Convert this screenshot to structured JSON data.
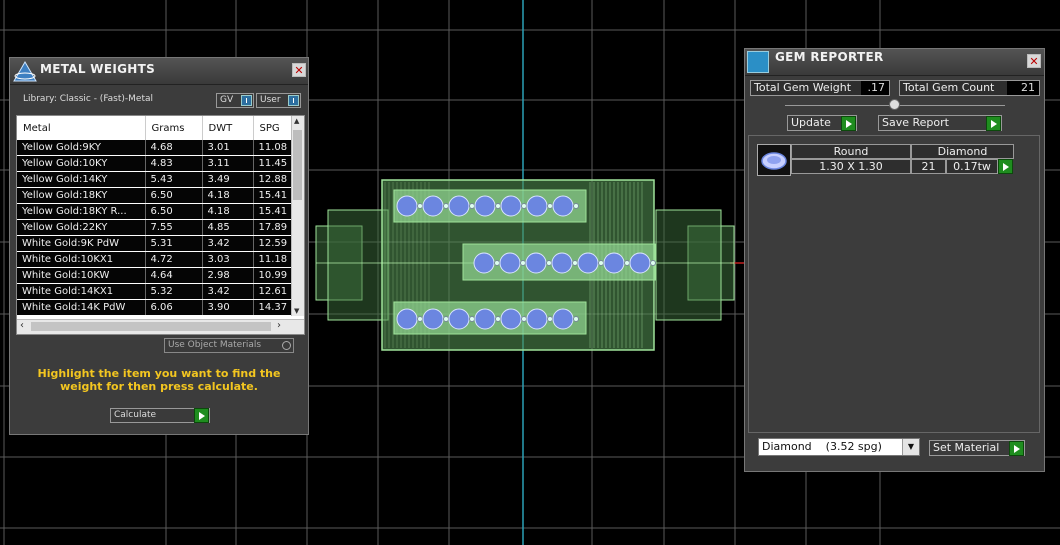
{
  "metal_weights": {
    "title": "METAL WEIGHTS",
    "library_label": "Library: Classic - (Fast)-Metal",
    "gv_label": "GV",
    "user_label": "User",
    "columns": [
      "Metal",
      "Grams",
      "DWT",
      "SPG"
    ],
    "rows": [
      [
        "Yellow Gold:9KY",
        "4.68",
        "3.01",
        "11.08"
      ],
      [
        "Yellow Gold:10KY",
        "4.83",
        "3.11",
        "11.45"
      ],
      [
        "Yellow Gold:14KY",
        "5.43",
        "3.49",
        "12.88"
      ],
      [
        "Yellow Gold:18KY",
        "6.50",
        "4.18",
        "15.41"
      ],
      [
        "Yellow Gold:18KY R...",
        "6.50",
        "4.18",
        "15.41"
      ],
      [
        "Yellow Gold:22KY",
        "7.55",
        "4.85",
        "17.89"
      ],
      [
        "White Gold:9K PdW",
        "5.31",
        "3.42",
        "12.59"
      ],
      [
        "White Gold:10KX1",
        "4.72",
        "3.03",
        "11.18"
      ],
      [
        "White Gold:10KW",
        "4.64",
        "2.98",
        "10.99"
      ],
      [
        "White Gold:14KX1",
        "5.32",
        "3.42",
        "12.61"
      ],
      [
        "White Gold:14K PdW",
        "6.06",
        "3.90",
        "14.37"
      ]
    ],
    "use_object_materials": "Use Object Materials",
    "hint": "Highlight the item you want to find the weight for then press calculate.",
    "calculate_label": "Calculate"
  },
  "gem_reporter": {
    "title": "GEM REPORTER",
    "total_weight_label": "Total Gem Weight",
    "total_weight_value": ".17",
    "total_count_label": "Total Gem Count",
    "total_count_value": "21",
    "update_label": "Update",
    "save_report_label": "Save Report",
    "gem_row": {
      "shape_header": "Round",
      "material_header": "Diamond",
      "size": "1.30 X 1.30",
      "count": "21",
      "weight": "0.17tw"
    },
    "material_select": "Diamond    (3.52 spg)",
    "set_material_label": "Set Material"
  },
  "colors": {
    "accent_green": "#1f8d1f",
    "hint_yellow": "#f3c620",
    "model_green": "#9fe39a",
    "gem_blue": "#6b86e0",
    "axis_cyan": "#2b9fb5"
  }
}
